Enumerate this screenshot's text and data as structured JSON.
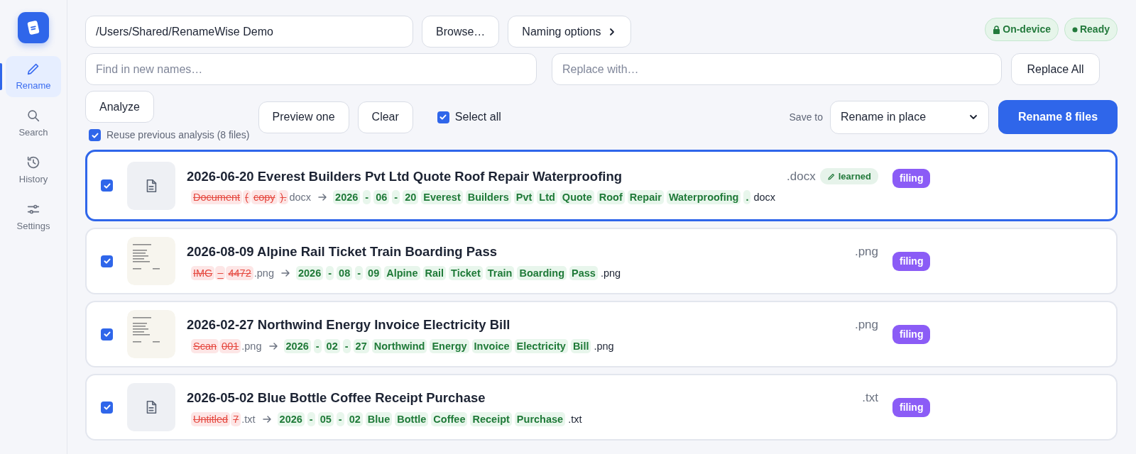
{
  "sidebar": {
    "items": [
      {
        "label": "Rename",
        "selected": true
      },
      {
        "label": "Search",
        "selected": false
      },
      {
        "label": "History",
        "selected": false
      },
      {
        "label": "Settings",
        "selected": false
      }
    ]
  },
  "toolbar": {
    "path": "/Users/Shared/RenameWise Demo",
    "browse": "Browse…",
    "naming_options": "Naming options",
    "status_badges": [
      {
        "label": "On-device"
      },
      {
        "label": "Ready"
      }
    ],
    "find": {
      "placeholder": "Find in new names…"
    },
    "replace": {
      "placeholder": "Replace with…"
    },
    "replace_all": "Replace All",
    "analyze": "Analyze",
    "reuse": {
      "label": "Reuse previous analysis (8 files)",
      "checked": true
    },
    "preview_one": "Preview one",
    "clear": "Clear",
    "select_all": {
      "label": "Select all",
      "checked": true
    },
    "save_to_label": "Save to",
    "save_to": "Rename in place",
    "rename": "Rename 8 files"
  },
  "files": [
    {
      "title": "2026-06-20 Everest Builders Pvt Ltd Quote Roof Repair Waterproofing",
      "ext": ".docx",
      "learned": "learned",
      "tag": "filing",
      "selected": true,
      "checked": true,
      "kind": "document",
      "old": [
        {
          "text": "Document",
          "kind": "removed"
        },
        {
          "text": "(",
          "kind": "removed"
        },
        {
          "text": "copy",
          "kind": "removed"
        },
        {
          "text": ").",
          "kind": "removed"
        },
        {
          "text": "docx",
          "kind": "kept"
        }
      ],
      "new": [
        {
          "text": "2026",
          "kind": "added"
        },
        {
          "text": "-",
          "kind": "added"
        },
        {
          "text": "06",
          "kind": "added"
        },
        {
          "text": "-",
          "kind": "added"
        },
        {
          "text": "20",
          "kind": "added"
        },
        {
          "text": "Everest",
          "kind": "added"
        },
        {
          "text": "Builders",
          "kind": "added"
        },
        {
          "text": "Pvt",
          "kind": "added"
        },
        {
          "text": "Ltd",
          "kind": "added"
        },
        {
          "text": "Quote",
          "kind": "added"
        },
        {
          "text": "Roof",
          "kind": "added"
        },
        {
          "text": "Repair",
          "kind": "added"
        },
        {
          "text": "Waterproofing",
          "kind": "added"
        },
        {
          "text": ".",
          "kind": "added"
        },
        {
          "text": "docx",
          "kind": "kept"
        }
      ]
    },
    {
      "title": "2026-08-09 Alpine Rail Ticket Train Boarding Pass",
      "ext": ".png",
      "tag": "filing",
      "selected": false,
      "checked": true,
      "kind": "picture",
      "old": [
        {
          "text": "IMG",
          "kind": "removed"
        },
        {
          "text": "_",
          "kind": "removed"
        },
        {
          "text": "4472",
          "kind": "removed"
        },
        {
          "text": ".png",
          "kind": "kept"
        }
      ],
      "new": [
        {
          "text": "2026",
          "kind": "added"
        },
        {
          "text": "-",
          "kind": "added"
        },
        {
          "text": "08",
          "kind": "added"
        },
        {
          "text": "-",
          "kind": "added"
        },
        {
          "text": "09",
          "kind": "added"
        },
        {
          "text": "Alpine",
          "kind": "added"
        },
        {
          "text": "Rail",
          "kind": "added"
        },
        {
          "text": "Ticket",
          "kind": "added"
        },
        {
          "text": "Train",
          "kind": "added"
        },
        {
          "text": "Boarding",
          "kind": "added"
        },
        {
          "text": "Pass",
          "kind": "added"
        },
        {
          "text": ".png",
          "kind": "kept"
        }
      ]
    },
    {
      "title": "2026-02-27 Northwind Energy Invoice Electricity Bill",
      "ext": ".png",
      "tag": "filing",
      "selected": false,
      "checked": true,
      "kind": "picture",
      "old": [
        {
          "text": "Scan",
          "kind": "removed"
        },
        {
          "text": "001",
          "kind": "removed"
        },
        {
          "text": ".png",
          "kind": "kept"
        }
      ],
      "new": [
        {
          "text": "2026",
          "kind": "added"
        },
        {
          "text": "-",
          "kind": "added"
        },
        {
          "text": "02",
          "kind": "added"
        },
        {
          "text": "-",
          "kind": "added"
        },
        {
          "text": "27",
          "kind": "added"
        },
        {
          "text": "Northwind",
          "kind": "added"
        },
        {
          "text": "Energy",
          "kind": "added"
        },
        {
          "text": "Invoice",
          "kind": "added"
        },
        {
          "text": "Electricity",
          "kind": "added"
        },
        {
          "text": "Bill",
          "kind": "added"
        },
        {
          "text": ".png",
          "kind": "kept"
        }
      ]
    },
    {
      "title": "2026-05-02 Blue Bottle Coffee Receipt Purchase",
      "ext": ".txt",
      "tag": "filing",
      "selected": false,
      "checked": true,
      "kind": "document",
      "old": [
        {
          "text": "Untitled",
          "kind": "removed"
        },
        {
          "text": "7",
          "kind": "removed"
        },
        {
          "text": ".txt",
          "kind": "kept"
        }
      ],
      "new": [
        {
          "text": "2026",
          "kind": "added"
        },
        {
          "text": "-",
          "kind": "added"
        },
        {
          "text": "05",
          "kind": "added"
        },
        {
          "text": "-",
          "kind": "added"
        },
        {
          "text": "02",
          "kind": "added"
        },
        {
          "text": "Blue",
          "kind": "added"
        },
        {
          "text": "Bottle",
          "kind": "added"
        },
        {
          "text": "Coffee",
          "kind": "added"
        },
        {
          "text": "Receipt",
          "kind": "added"
        },
        {
          "text": "Purchase",
          "kind": "added"
        },
        {
          "text": ".txt",
          "kind": "kept"
        }
      ]
    }
  ]
}
